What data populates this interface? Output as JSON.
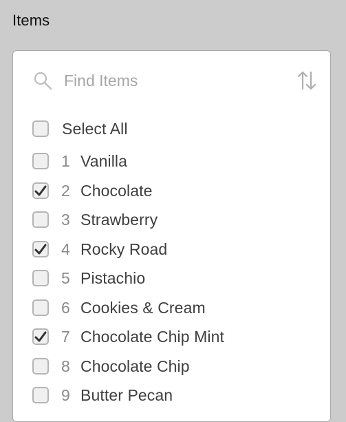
{
  "section": {
    "title": "Items"
  },
  "search": {
    "placeholder": "Find Items",
    "value": "",
    "icon": "search-icon",
    "sort_icon": "sort-icon"
  },
  "select_all": {
    "label": "Select All",
    "checked": false
  },
  "items": [
    {
      "num": "1",
      "label": "Vanilla",
      "checked": false
    },
    {
      "num": "2",
      "label": "Chocolate",
      "checked": true
    },
    {
      "num": "3",
      "label": "Strawberry",
      "checked": false
    },
    {
      "num": "4",
      "label": "Rocky Road",
      "checked": true
    },
    {
      "num": "5",
      "label": "Pistachio",
      "checked": false
    },
    {
      "num": "6",
      "label": "Cookies & Cream",
      "checked": false
    },
    {
      "num": "7",
      "label": "Chocolate Chip Mint",
      "checked": true
    },
    {
      "num": "8",
      "label": "Chocolate Chip",
      "checked": false
    },
    {
      "num": "9",
      "label": "Butter Pecan",
      "checked": false
    }
  ],
  "colors": {
    "background": "#cccccc",
    "panel": "#ffffff",
    "text": "#3f3f3f",
    "muted": "#8a8a8a",
    "checkbox_border": "#b5b5b5",
    "checkmark": "#333333"
  }
}
